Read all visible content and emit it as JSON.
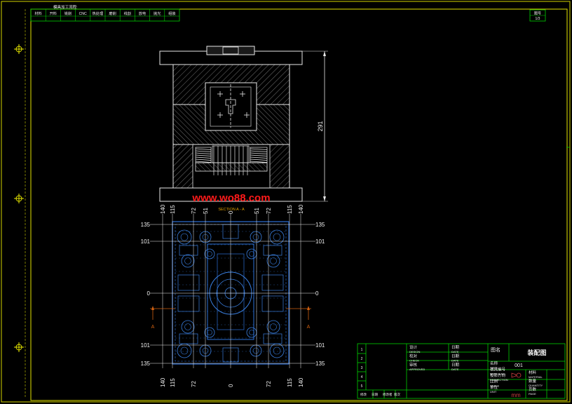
{
  "process_header": {
    "title": "模具加工流程:",
    "cells": [
      "材料",
      "开料",
      "铣削",
      "CNC",
      "热处理",
      "磨削",
      "线割",
      "放电",
      "抛光",
      "组装"
    ]
  },
  "corner_box": {
    "label": "图号",
    "value": "1/3"
  },
  "section_label": "SECTION A - A",
  "watermark": "www.wo88.com",
  "dimension_height": "291",
  "plan_dims": {
    "top": [
      "140",
      "115",
      "72",
      "51",
      "0",
      "51",
      "72",
      "115",
      "140"
    ],
    "bottom": [
      "140",
      "115",
      "72",
      "0",
      "72",
      "115",
      "140"
    ],
    "left": [
      "135",
      "101",
      "0",
      "101",
      "135"
    ],
    "right": [
      "135",
      "101",
      "0",
      "101",
      "135"
    ],
    "section_mark": "A"
  },
  "title_block": {
    "drawing_name_label": "图名",
    "drawing_name": "装配图",
    "drawing_no": "001",
    "rows_left": [
      {
        "cn": "设计",
        "en": "DESIGN"
      },
      {
        "cn": "校对",
        "en": "CHECK"
      },
      {
        "cn": "审核",
        "en": "APPROVED"
      }
    ],
    "rows_mid": [
      {
        "cn": "日期",
        "en": "DATE"
      },
      {
        "cn": "日期",
        "en": "DATE"
      },
      {
        "cn": "日期",
        "en": "DATE"
      }
    ],
    "rows_right": [
      {
        "cn": "名称",
        "en": "TITLE"
      },
      {
        "cn": "模具编号",
        "en": "MOULD NO."
      },
      {
        "cn": "投影方向",
        "en": "PROJECTION"
      },
      {
        "cn": "比例",
        "en": "SCALE"
      },
      {
        "cn": "单位",
        "en": "UNIT"
      }
    ],
    "unit_value": "mm",
    "right_cells": [
      {
        "cn": "材料",
        "en": "MATERIAL"
      },
      {
        "cn": "数量",
        "en": "QUANTITY"
      },
      {
        "cn": "页数",
        "en": "PAGE"
      }
    ],
    "revision_marks": [
      "1",
      "2",
      "3",
      "4",
      "5"
    ],
    "bottom_row": [
      "修改",
      "日期",
      "修改者",
      "版次"
    ]
  },
  "colors": {
    "border": "#e6e600",
    "line_green": "#00d000",
    "line_white": "#e8e8e8",
    "watermark": "#ff1a1a",
    "plan_blue": "#2c6fd6",
    "dim_white": "#f0f0f0",
    "section_orange": "#d06010"
  }
}
